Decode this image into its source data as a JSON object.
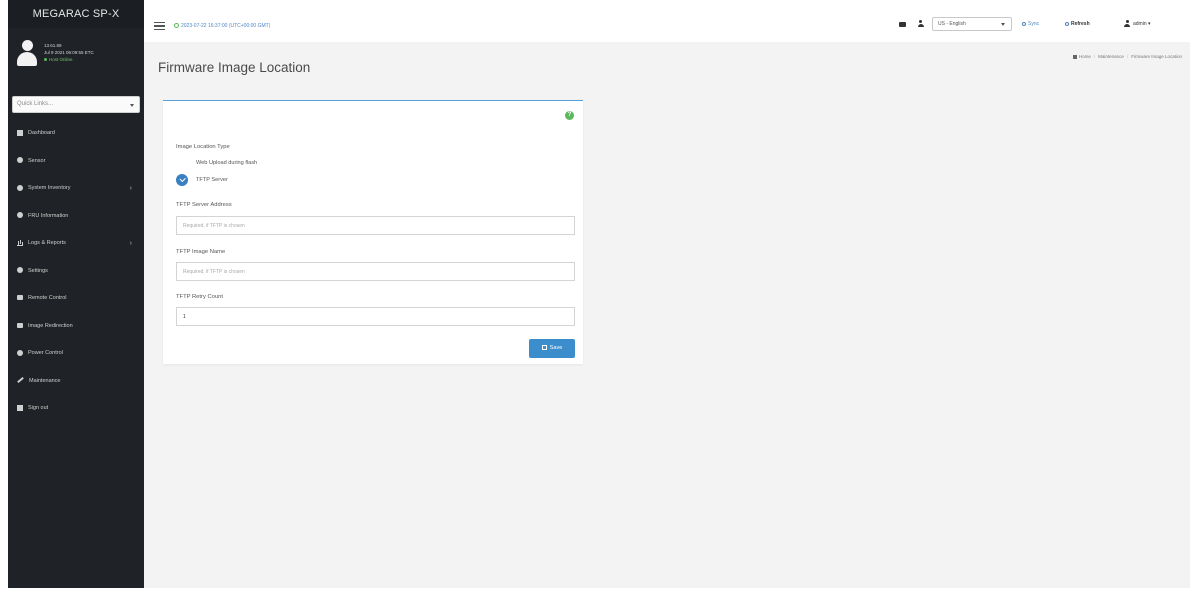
{
  "app": {
    "brand": "MEGARAC SP-X"
  },
  "user": {
    "line1": "13.61.89",
    "line2": "Jul 9 2021 06:09:55 ETC",
    "status": "Host Online"
  },
  "sidebar": {
    "quick_links_placeholder": "Quick Links...",
    "items": [
      {
        "label": "Dashboard",
        "icon": "dashboard-icon"
      },
      {
        "label": "Sensor",
        "icon": "sensor-icon"
      },
      {
        "label": "System Inventory",
        "icon": "inventory-icon",
        "has_submenu": true
      },
      {
        "label": "FRU Information",
        "icon": "fru-icon"
      },
      {
        "label": "Logs & Reports",
        "icon": "logs-icon",
        "has_submenu": true
      },
      {
        "label": "Settings",
        "icon": "settings-icon"
      },
      {
        "label": "Remote Control",
        "icon": "monitor-icon"
      },
      {
        "label": "Image Redirection",
        "icon": "image-redirection-icon"
      },
      {
        "label": "Power Control",
        "icon": "power-icon"
      },
      {
        "label": "Maintenance",
        "icon": "wrench-icon"
      },
      {
        "label": "Sign out",
        "icon": "sign-out-icon"
      }
    ],
    "chevron": "›"
  },
  "header": {
    "datetime": "2023-07-22 16:37:00 (UTC+00:00 GMT)",
    "language": "US - English",
    "sync_label": "Sync",
    "refresh_label": "Refresh",
    "admin_label": "admin",
    "admin_caret": "▾"
  },
  "breadcrumb": {
    "home": "Home",
    "section": "Maintenance",
    "current": "Firmware Image Location",
    "sep": "/"
  },
  "page": {
    "title": "Firmware Image Location"
  },
  "form": {
    "help_glyph": "?",
    "location_type_label": "Image Location Type",
    "options": [
      {
        "label": "Web Upload during flash",
        "checked": false
      },
      {
        "label": "TFTP Server",
        "checked": true
      }
    ],
    "server_address_label": "TFTP Server Address",
    "server_address_placeholder": "Required, if TFTP is chosen",
    "image_name_label": "TFTP Image Name",
    "image_name_placeholder": "Required, if TFTP is chosen",
    "retry_label": "TFTP Retry Count",
    "retry_value": "1",
    "save_label": "Save"
  },
  "colors": {
    "sidebar_bg": "#1f2327",
    "accent": "#3c8dcb",
    "help_green": "#5cb85c"
  }
}
